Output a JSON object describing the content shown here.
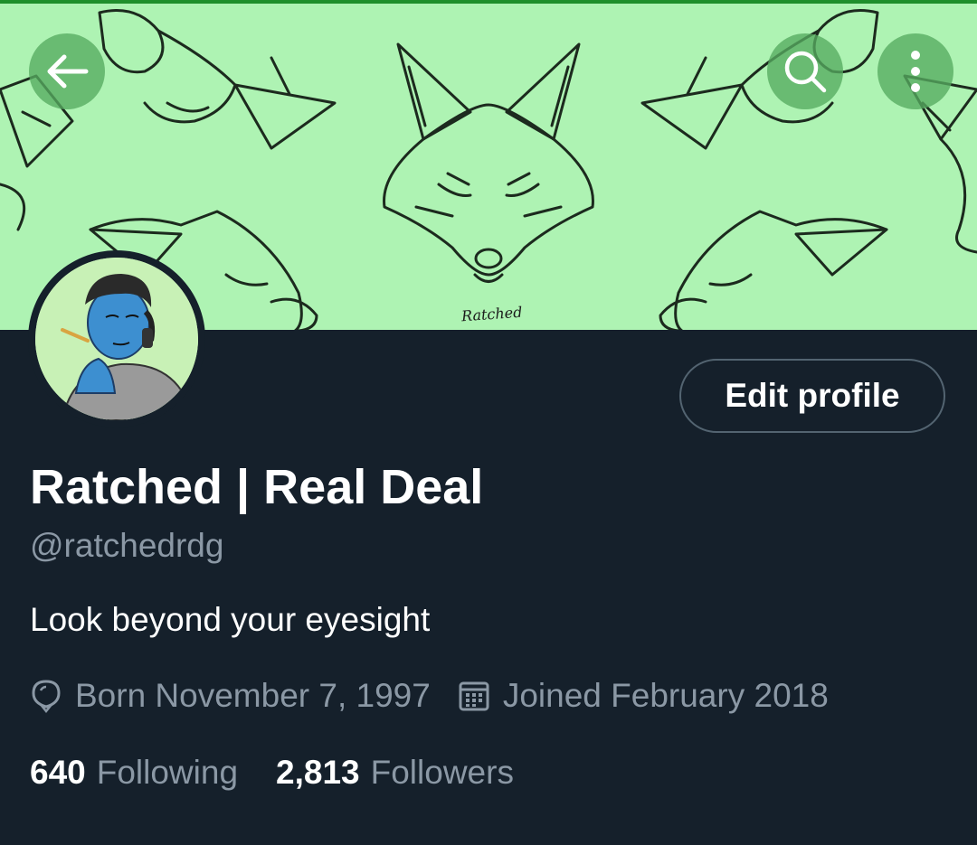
{
  "header": {
    "banner_signature": "Ratched",
    "back_icon": "arrow-left-icon",
    "search_icon": "search-icon",
    "more_icon": "more-vertical-icon",
    "banner_color": "#aef3b3"
  },
  "profile": {
    "display_name": "Ratched | Real Deal",
    "handle": "@ratchedrdg",
    "bio": "Look beyond your eyesight",
    "birthday": "Born November 7, 1997",
    "joined": "Joined February 2018",
    "edit_button_label": "Edit profile"
  },
  "stats": {
    "following_count": "640",
    "following_label": "Following",
    "followers_count": "2,813",
    "followers_label": "Followers"
  },
  "colors": {
    "background": "#15202b",
    "secondary_text": "#8b98a5",
    "primary_text": "#ffffff"
  }
}
